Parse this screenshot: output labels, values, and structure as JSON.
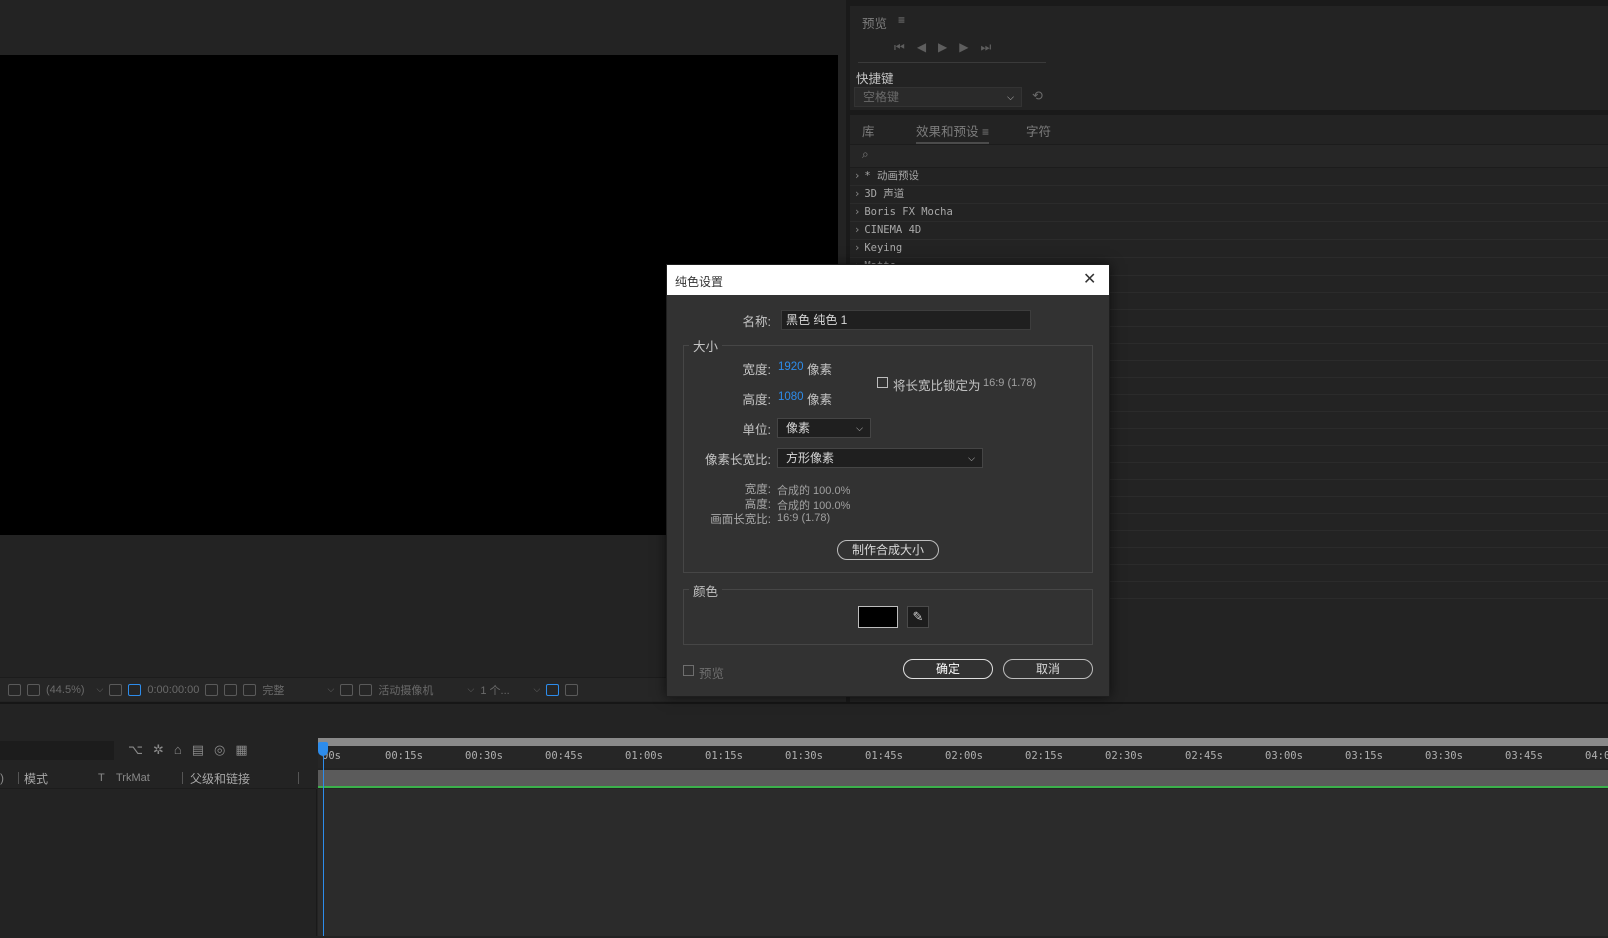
{
  "composition": {
    "zoom": "(44.5%)",
    "timecode": "0:00:00:00",
    "resolution": "完整",
    "camera": "活动摄像机",
    "views": "1 个..."
  },
  "preview_panel": {
    "title": "预览",
    "shortcut_label": "快捷键",
    "shortcut_value": "空格键"
  },
  "effects_panel": {
    "tabs": [
      {
        "label": "库"
      },
      {
        "label": "效果和预设"
      },
      {
        "label": "字符"
      }
    ],
    "items": [
      {
        "label": "* 动画预设"
      },
      {
        "label": "3D 声道"
      },
      {
        "label": "Boris FX Mocha"
      },
      {
        "label": "CINEMA 4D"
      },
      {
        "label": "Keying"
      },
      {
        "label": "Matte"
      }
    ]
  },
  "timeline": {
    "columns": {
      "mode": "模式",
      "t": "T",
      "trkmat": "TrkMat",
      "parent": "父级和链接"
    },
    "ticks": [
      "00s",
      "00:15s",
      "00:30s",
      "00:45s",
      "01:00s",
      "01:15s",
      "01:30s",
      "01:45s",
      "02:00s",
      "02:15s",
      "02:30s",
      "02:45s",
      "03:00s",
      "03:15s",
      "03:30s",
      "03:45s",
      "04:0"
    ]
  },
  "dialog": {
    "title": "纯色设置",
    "name_label": "名称:",
    "name_value": "黑色 纯色 1",
    "size_group": "大小",
    "width_label": "宽度:",
    "width_value": "1920",
    "width_unit": "像素",
    "height_label": "高度:",
    "height_value": "1080",
    "height_unit": "像素",
    "lock_label": "将长宽比锁定为",
    "lock_ratio": "16:9 (1.78)",
    "units_label": "单位:",
    "units_value": "像素",
    "par_label": "像素长宽比:",
    "par_value": "方形像素",
    "info_width_label": "宽度:",
    "info_width_value": "合成的 100.0%",
    "info_height_label": "高度:",
    "info_height_value": "合成的 100.0%",
    "info_frame_label": "画面长宽比:",
    "info_frame_value": "16:9 (1.78)",
    "make_comp_size": "制作合成大小",
    "color_group": "颜色",
    "swatch_color": "#000000",
    "preview_label": "预览",
    "ok": "确定",
    "cancel": "取消"
  }
}
